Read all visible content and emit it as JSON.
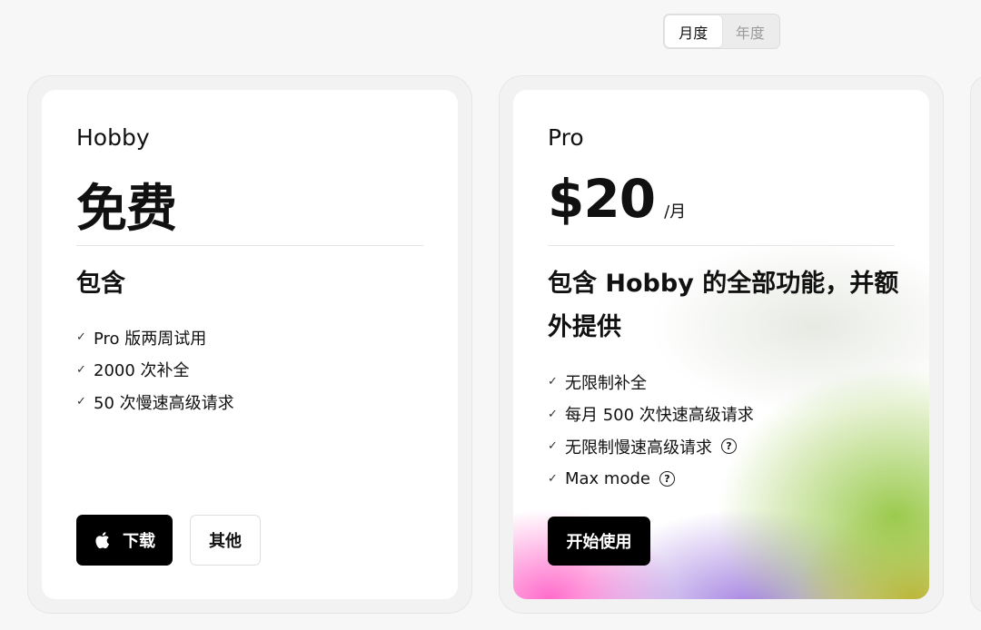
{
  "billing_toggle": {
    "monthly": "月度",
    "yearly": "年度"
  },
  "plans": [
    {
      "name": "Hobby",
      "price": "免费",
      "includes_heading": "包含",
      "features": [
        "Pro 版两周试用",
        "2000 次补全",
        "50 次慢速高级请求"
      ],
      "primary_button": "下载",
      "secondary_button": "其他"
    },
    {
      "name": "Pro",
      "price": "$20",
      "per": "/月",
      "includes_heading": "包含 Hobby 的全部功能，并额外提供",
      "features": [
        "无限制补全",
        "每月 500 次快速高级请求",
        "无限制慢速高级请求",
        "Max mode"
      ],
      "primary_button": "开始使用"
    }
  ],
  "icons": {
    "check": "check-icon",
    "info": "info-icon",
    "apple": "apple-icon"
  }
}
